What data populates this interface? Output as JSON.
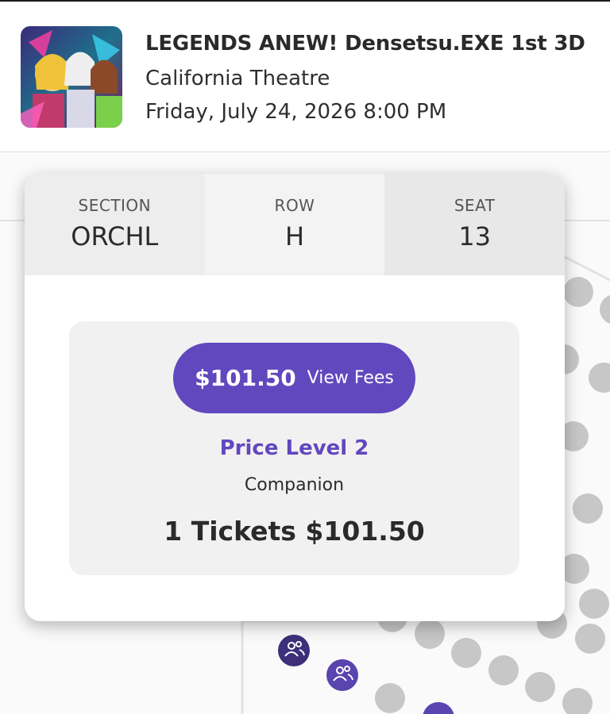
{
  "event": {
    "title": "LEGENDS ANEW! Densetsu.EXE 1st 3D",
    "venue": "California Theatre",
    "datetime": "Friday, July 24, 2026 8:00 PM",
    "thumbnail_icon": "event-artwork"
  },
  "seat": {
    "section_label": "SECTION",
    "section_value": "ORCHL",
    "row_label": "ROW",
    "row_value": "H",
    "seat_label": "SEAT",
    "seat_value": "13"
  },
  "pricing": {
    "price": "$101.50",
    "view_fees": "View Fees",
    "price_level": "Price Level 2",
    "ticket_type": "Companion",
    "total": "1 Tickets $101.50"
  },
  "colors": {
    "accent": "#6148be",
    "companion_seat": "#3d2f7a",
    "available_seat": "#c7c7c7"
  },
  "map": {
    "seat_icon": "companion-icon"
  }
}
